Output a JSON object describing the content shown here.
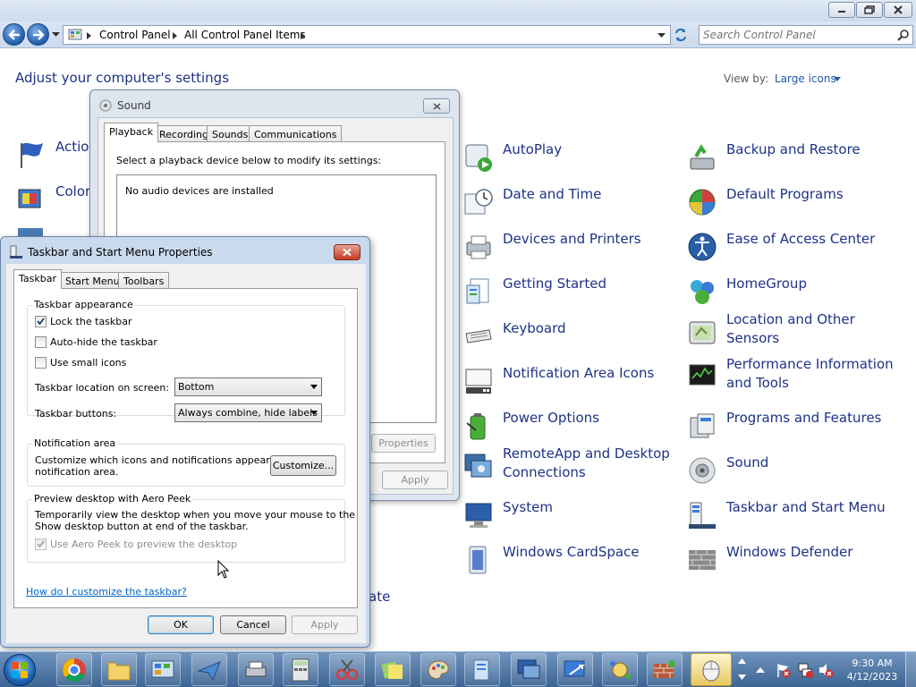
{
  "control_panel": {
    "breadcrumb": [
      "Control Panel",
      "All Control Panel Items"
    ],
    "search_placeholder": "Search Control Panel",
    "heading": "Adjust your computer's settings",
    "view_by_label": "View by:",
    "view_by_value": "Large icons",
    "partial_items": [
      "Action",
      "Color",
      "ate"
    ],
    "items_col2": [
      "AutoPlay",
      "Date and Time",
      "Devices and Printers",
      "Getting Started",
      "Keyboard",
      "Notification Area Icons",
      "Power Options",
      "RemoteApp and Desktop Connections",
      "System",
      "Windows CardSpace"
    ],
    "items_col3": [
      "Backup and Restore",
      "Default Programs",
      "Ease of Access Center",
      "HomeGroup",
      "Location and Other Sensors",
      "Performance Information and Tools",
      "Programs and Features",
      "Sound",
      "Taskbar and Start Menu",
      "Windows Defender"
    ]
  },
  "sound_dialog": {
    "title": "Sound",
    "tabs": [
      "Playback",
      "Recording",
      "Sounds",
      "Communications"
    ],
    "instruction": "Select a playback device below to modify its settings:",
    "empty_message": "No audio devices are installed",
    "properties_button": "Properties",
    "apply_button": "Apply"
  },
  "taskbar_dialog": {
    "title": "Taskbar and Start Menu Properties",
    "tabs": [
      "Taskbar",
      "Start Menu",
      "Toolbars"
    ],
    "appearance_group": "Taskbar appearance",
    "lock_taskbar": "Lock the taskbar",
    "lock_taskbar_checked": true,
    "auto_hide": "Auto-hide the taskbar",
    "auto_hide_checked": false,
    "small_icons": "Use small icons",
    "small_icons_checked": false,
    "location_label": "Taskbar location on screen:",
    "location_value": "Bottom",
    "buttons_label": "Taskbar buttons:",
    "buttons_value": "Always combine, hide labels",
    "notification_group": "Notification area",
    "notification_text_1": "Customize which icons and notifications appear in the",
    "notification_text_2": "notification area.",
    "customize_button": "Customize...",
    "aero_group": "Preview desktop with Aero Peek",
    "aero_text_1": "Temporarily view the desktop when you move your mouse to the",
    "aero_text_2": "Show desktop button at end of the taskbar.",
    "aero_checkbox": "Use Aero Peek to preview the desktop",
    "aero_checked": true,
    "help_link": "How do I customize the taskbar?",
    "ok_button": "OK",
    "cancel_button": "Cancel",
    "apply_button": "Apply"
  },
  "taskbar": {
    "time": "9:30 AM",
    "date": "4/12/2023"
  }
}
